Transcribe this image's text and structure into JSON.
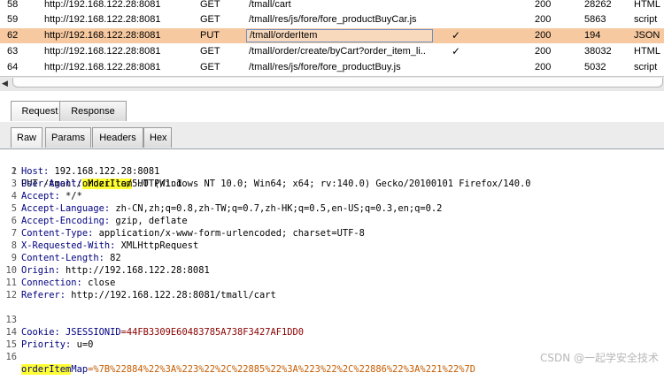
{
  "history": [
    {
      "num": "58",
      "host": "http://192.168.122.28:8081",
      "method": "GET",
      "url": "/tmall/cart",
      "check": "",
      "status": "200",
      "length": "28262",
      "mime": "HTML",
      "selected": false
    },
    {
      "num": "59",
      "host": "http://192.168.122.28:8081",
      "method": "GET",
      "url": "/tmall/res/js/fore/fore_productBuyCar.js",
      "check": "",
      "status": "200",
      "length": "5863",
      "mime": "script",
      "selected": false
    },
    {
      "num": "62",
      "host": "http://192.168.122.28:8081",
      "method": "PUT",
      "url": "/tmall/orderItem",
      "check": "✓",
      "status": "200",
      "length": "194",
      "mime": "JSON",
      "selected": true
    },
    {
      "num": "63",
      "host": "http://192.168.122.28:8081",
      "method": "GET",
      "url": "/tmall/order/create/byCart?order_item_li...",
      "check": "✓",
      "status": "200",
      "length": "38032",
      "mime": "HTML",
      "selected": false
    },
    {
      "num": "64",
      "host": "http://192.168.122.28:8081",
      "method": "GET",
      "url": "/tmall/res/js/fore/fore_productBuy.js",
      "check": "",
      "status": "200",
      "length": "5032",
      "mime": "script",
      "selected": false
    }
  ],
  "tabs_top": {
    "request": "Request",
    "response": "Response"
  },
  "tabs_view": {
    "raw": "Raw",
    "params": "Params",
    "headers": "Headers",
    "hex": "Hex"
  },
  "request_line": {
    "num": "1",
    "method_path": "PUT /tmall/",
    "highlight": "orderItem",
    "rest": " HTTP/1.1"
  },
  "headers": [
    {
      "num": "2",
      "name": "Host:",
      "value": " 192.168.122.28:8081"
    },
    {
      "num": "3",
      "name": "User-Agent:",
      "value": " Mozilla/5.0 (Windows NT 10.0; Win64; x64; rv:140.0) Gecko/20100101 Firefox/140.0"
    },
    {
      "num": "4",
      "name": "Accept:",
      "value": " */*"
    },
    {
      "num": "5",
      "name": "Accept-Language:",
      "value": " zh-CN,zh;q=0.8,zh-TW;q=0.7,zh-HK;q=0.5,en-US;q=0.3,en;q=0.2"
    },
    {
      "num": "6",
      "name": "Accept-Encoding:",
      "value": " gzip, deflate"
    },
    {
      "num": "7",
      "name": "Content-Type:",
      "value": " application/x-www-form-urlencoded; charset=UTF-8"
    },
    {
      "num": "8",
      "name": "X-Requested-With:",
      "value": " XMLHttpRequest"
    },
    {
      "num": "9",
      "name": "Content-Length:",
      "value": " 82"
    },
    {
      "num": "10",
      "name": "Origin:",
      "value": " http://192.168.122.28:8081"
    },
    {
      "num": "11",
      "name": "Connection:",
      "value": " close"
    },
    {
      "num": "12",
      "name": "Referer:",
      "value": " http://192.168.122.28:8081/tmall/cart"
    }
  ],
  "cookie": {
    "num": "13",
    "name": "Cookie:",
    "key": " JSESSIONID",
    "value": "=44FB3309E60483785A738F3427AF1DD0"
  },
  "priority": {
    "num": "14",
    "name": "Priority:",
    "value": " u=0"
  },
  "blank": {
    "num": "15"
  },
  "body": {
    "num": "16",
    "highlight": "orderItem",
    "key": "Map",
    "value": "=%7B%22884%22%3A%223%22%2C%22885%22%3A%223%22%2C%22886%22%3A%221%22%7D"
  },
  "watermark": "CSDN @一起学安全技术"
}
